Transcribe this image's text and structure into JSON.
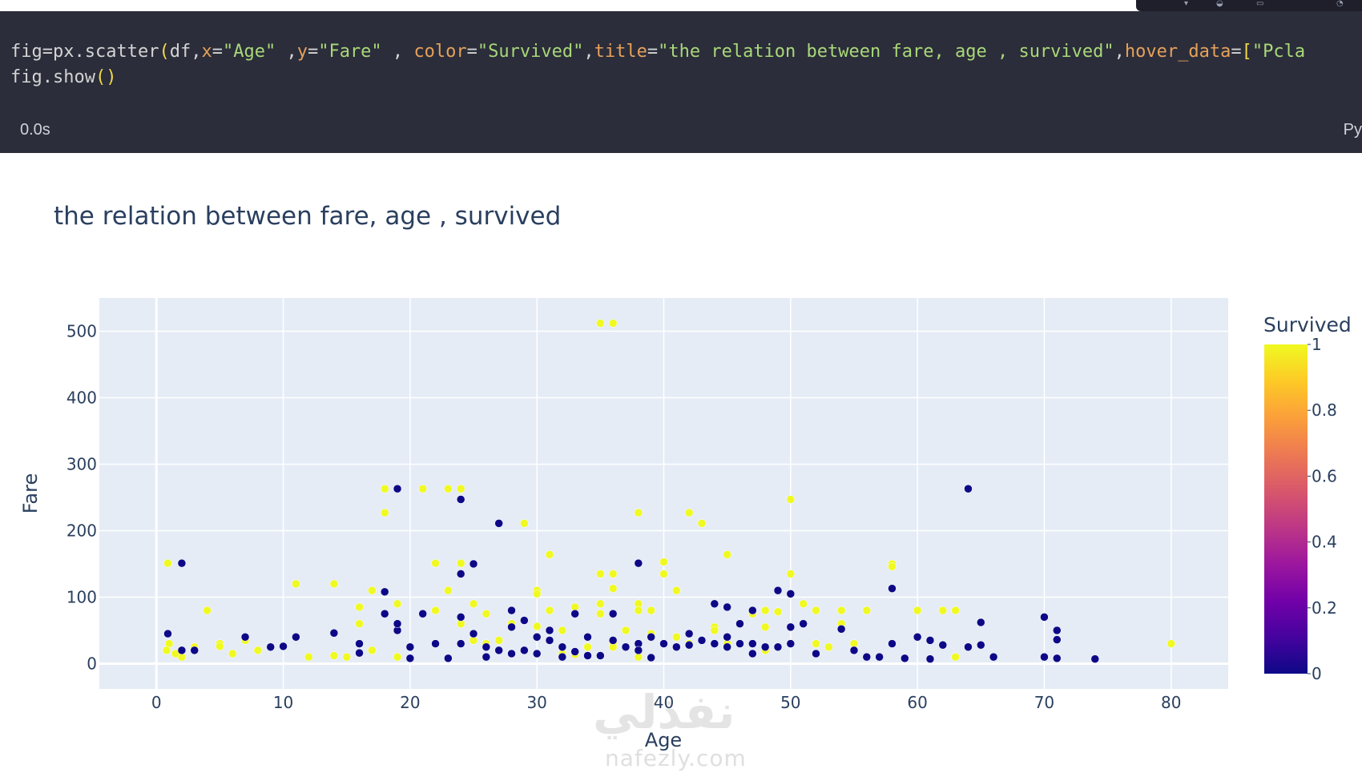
{
  "code_cell": {
    "line1": [
      {
        "t": "fig",
        "c": "var"
      },
      {
        "t": "=",
        "c": "op"
      },
      {
        "t": "px",
        "c": "var"
      },
      {
        "t": ".",
        "c": "op"
      },
      {
        "t": "scatter",
        "c": "var"
      },
      {
        "t": "(",
        "c": "paren"
      },
      {
        "t": "df",
        "c": "var"
      },
      {
        "t": ",",
        "c": "op"
      },
      {
        "t": "x",
        "c": "kw"
      },
      {
        "t": "=",
        "c": "op"
      },
      {
        "t": "\"Age\"",
        "c": "str"
      },
      {
        "t": " ,",
        "c": "op"
      },
      {
        "t": "y",
        "c": "kw"
      },
      {
        "t": "=",
        "c": "op"
      },
      {
        "t": "\"Fare\"",
        "c": "str"
      },
      {
        "t": " , ",
        "c": "op"
      },
      {
        "t": "color",
        "c": "kw"
      },
      {
        "t": "=",
        "c": "op"
      },
      {
        "t": "\"Survived\"",
        "c": "str"
      },
      {
        "t": ",",
        "c": "op"
      },
      {
        "t": "title",
        "c": "kw"
      },
      {
        "t": "=",
        "c": "op"
      },
      {
        "t": "\"the relation between fare, age , survived\"",
        "c": "str"
      },
      {
        "t": ",",
        "c": "op"
      },
      {
        "t": "hover_data",
        "c": "kw"
      },
      {
        "t": "=",
        "c": "op"
      },
      {
        "t": "[",
        "c": "paren"
      },
      {
        "t": "\"Pcla",
        "c": "str"
      }
    ],
    "line2": [
      {
        "t": "fig",
        "c": "var"
      },
      {
        "t": ".",
        "c": "op"
      },
      {
        "t": "show",
        "c": "var"
      },
      {
        "t": "()",
        "c": "paren"
      }
    ],
    "exec_time": "0.0s",
    "language_badge": "Py"
  },
  "colors": {
    "cell_bg": "#2b2d3a",
    "plot_bg": "#e5ecf6",
    "survived_1": "#f0f921",
    "survived_0": "#0d0887"
  },
  "watermark": {
    "arabic": "نفذلي",
    "latin": "nafezly.com"
  },
  "chart_data": {
    "type": "scatter",
    "title": "the relation between fare, age , survived",
    "xlabel": "Age",
    "ylabel": "Fare",
    "xlim": [
      -4.5,
      84.5
    ],
    "ylim": [
      -38,
      550
    ],
    "x_ticks": [
      0,
      10,
      20,
      30,
      40,
      50,
      60,
      70,
      80
    ],
    "y_ticks": [
      0,
      100,
      200,
      300,
      400,
      500
    ],
    "grid": true,
    "colorbar": {
      "title": "Survived",
      "ticks": [
        "1",
        "0.8",
        "0.6",
        "0.4",
        "0.2",
        "0"
      ],
      "colorscale": [
        "#0d0887",
        "#46039f",
        "#7201a8",
        "#9c179e",
        "#bd3786",
        "#d8576b",
        "#ed7953",
        "#fb9f3a",
        "#fdca26",
        "#f0f921"
      ]
    },
    "series": [
      {
        "name": "1",
        "x": [
          35,
          36,
          0.9,
          2,
          4,
          5,
          6,
          7,
          8,
          11,
          14,
          15,
          16,
          17,
          18,
          18,
          19,
          19,
          21,
          22,
          22,
          23,
          23,
          24,
          24,
          24,
          25,
          26,
          27,
          28,
          29,
          30,
          30,
          31,
          31,
          32,
          33,
          34,
          35,
          35,
          35,
          36,
          36,
          36,
          37,
          38,
          38,
          38,
          39,
          39,
          40,
          40,
          41,
          42,
          43,
          44,
          45,
          45,
          46,
          47,
          48,
          48,
          49,
          50,
          50,
          51,
          52,
          53,
          54,
          54,
          55,
          56,
          58,
          58,
          60,
          62,
          63,
          80,
          1,
          3,
          16,
          22,
          24,
          26,
          28,
          30,
          33,
          36,
          42,
          49,
          52,
          0.8,
          1.5,
          5,
          12,
          14,
          17,
          25,
          32,
          38,
          41,
          44,
          48,
          56,
          63
        ],
        "y": [
          512,
          512,
          151,
          10,
          80,
          30,
          15,
          35,
          20,
          120,
          120,
          10,
          85,
          110,
          263,
          227,
          90,
          10,
          263,
          151,
          30,
          263,
          110,
          263,
          151,
          30,
          90,
          30,
          35,
          15,
          211,
          110,
          105,
          164,
          80,
          50,
          85,
          25,
          135,
          75,
          90,
          135,
          113,
          30,
          50,
          227,
          90,
          80,
          80,
          45,
          153,
          135,
          110,
          227,
          211,
          55,
          164,
          30,
          60,
          75,
          80,
          55,
          25,
          247,
          135,
          90,
          80,
          25,
          80,
          60,
          30,
          80,
          150,
          146,
          80,
          80,
          80,
          30,
          30,
          25,
          60,
          80,
          60,
          75,
          60,
          56,
          14,
          25,
          30,
          78,
          30,
          20,
          15,
          26,
          10,
          12,
          20,
          35,
          15,
          10,
          40,
          50,
          20,
          10,
          10
        ],
        "color": "#f0f921"
      },
      {
        "name": "0",
        "x": [
          19,
          24,
          27,
          38,
          64,
          2,
          18,
          24,
          25,
          49,
          50,
          58,
          44,
          45,
          47,
          2,
          19,
          21,
          24,
          28,
          29,
          31,
          33,
          36,
          38,
          42,
          44,
          46,
          50,
          51,
          54,
          58,
          60,
          61,
          62,
          64,
          65,
          66,
          70,
          71,
          71,
          74,
          70,
          71,
          0.9,
          3,
          7,
          9,
          10,
          11,
          14,
          16,
          18,
          19,
          20,
          22,
          24,
          25,
          26,
          27,
          28,
          29,
          30,
          31,
          32,
          33,
          34,
          36,
          37,
          38,
          39,
          40,
          41,
          42,
          43,
          44,
          45,
          46,
          47,
          48,
          49,
          50,
          52,
          55,
          57,
          59,
          61,
          65,
          23,
          26,
          35,
          40,
          45,
          28,
          30,
          34,
          16,
          20,
          32,
          39,
          47,
          56
        ],
        "y": [
          263,
          247,
          211,
          151,
          263,
          151,
          108,
          135,
          150,
          110,
          105,
          113,
          90,
          85,
          80,
          20,
          50,
          75,
          70,
          80,
          65,
          35,
          75,
          75,
          30,
          45,
          30,
          60,
          55,
          60,
          52,
          30,
          40,
          35,
          28,
          25,
          62,
          10,
          70,
          50,
          8,
          7,
          10,
          36,
          45,
          20,
          40,
          25,
          26,
          40,
          46,
          30,
          75,
          60,
          25,
          30,
          30,
          45,
          25,
          20,
          55,
          20,
          40,
          50,
          25,
          18,
          40,
          35,
          25,
          20,
          40,
          30,
          25,
          28,
          35,
          30,
          40,
          30,
          30,
          25,
          25,
          30,
          15,
          20,
          10,
          8,
          7,
          28,
          8,
          10,
          12,
          30,
          25,
          15,
          15,
          12,
          16,
          8,
          10,
          9,
          15,
          10
        ],
        "color": "#0d0887"
      }
    ]
  }
}
